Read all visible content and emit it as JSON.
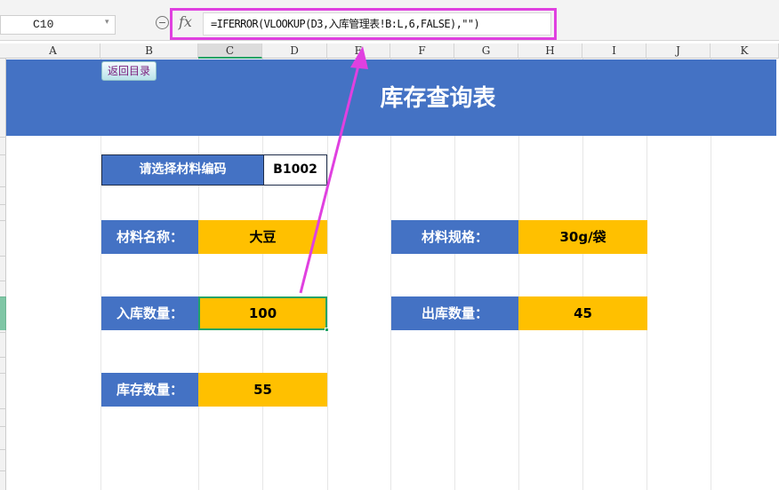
{
  "formula_bar": {
    "name_box": "C10",
    "formula": "=IFERROR(VLOOKUP(D3,入库管理表!B:L,6,FALSE),\"\")",
    "fx_label": "fx"
  },
  "columns": [
    "A",
    "B",
    "C",
    "D",
    "E",
    "F",
    "G",
    "H",
    "I",
    "J",
    "K"
  ],
  "sheet": {
    "back_button": "返回目录",
    "title": "库存查询表",
    "selector": {
      "label": "请选择材料编码",
      "value": "B1002"
    },
    "fields": {
      "material_name": {
        "label": "材料名称：",
        "value": "大豆"
      },
      "material_spec": {
        "label": "材料规格：",
        "value": "30g/袋"
      },
      "inbound_qty": {
        "label": "入库数量：",
        "value": "100"
      },
      "outbound_qty": {
        "label": "出库数量：",
        "value": "45"
      },
      "stock_qty": {
        "label": "库存数量：",
        "value": "55"
      }
    }
  },
  "colors": {
    "header_blue": "#4472c4",
    "value_gold": "#ffc000",
    "annotation_magenta": "#e040e0",
    "selection_green": "#21a366"
  }
}
